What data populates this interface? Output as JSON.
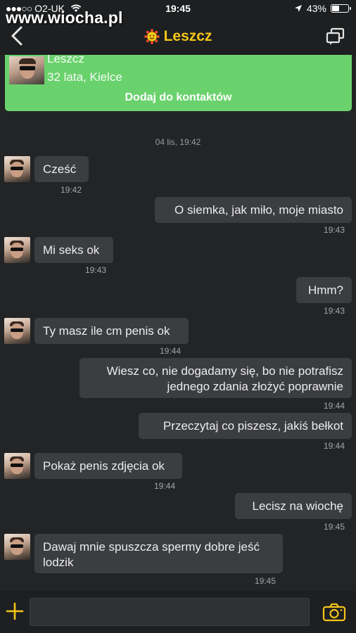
{
  "status_bar": {
    "carrier": "O2-UK",
    "time": "19:45",
    "battery": "43%",
    "battery_level": 0.43
  },
  "watermark": "www.wiocha.pl",
  "nav": {
    "title": "Leszcz",
    "icons": {
      "back": "chevron-left-icon",
      "title": "sun-smiley-icon",
      "action": "switch-windows-icon"
    }
  },
  "profile_card": {
    "name": "Leszcz",
    "details": "32 lata, Kielce",
    "add_button": "Dodaj do kontaktów",
    "color": "#6ad26d"
  },
  "date_separator": "04 lis, 19:42",
  "messages": [
    {
      "side": "in",
      "text": "Cześć",
      "time": "19:42"
    },
    {
      "side": "out",
      "text": "O siemka, jak miło, moje miasto",
      "time": "19:43"
    },
    {
      "side": "in",
      "text": "Mi seks ok",
      "time": "19:43"
    },
    {
      "side": "out",
      "text": "Hmm?",
      "time": "19:43"
    },
    {
      "side": "in",
      "text": "Ty masz ile cm penis ok",
      "time": "19:44"
    },
    {
      "side": "out",
      "text_lines": [
        "Wiesz co, nie dogadamy się, bo nie potrafisz",
        "jednego zdania złożyć poprawnie"
      ],
      "time": "19:44"
    },
    {
      "side": "out",
      "text": "Przeczytaj co piszesz, jakiś bełkot",
      "time": "19:44"
    },
    {
      "side": "in",
      "text": "Pokaż penis zdjęcia ok",
      "time": "19:44"
    },
    {
      "side": "out",
      "text": "Lecisz na wiochę",
      "time": "19:45"
    },
    {
      "side": "in",
      "text_lines": [
        "Dawaj mnie spuszcza spermy dobre jeść",
        "lodzik"
      ],
      "time": "19:45"
    }
  ],
  "composer": {
    "value": "",
    "placeholder": "",
    "icons": {
      "add": "plus-icon",
      "camera": "camera-icon"
    }
  },
  "colors": {
    "accent": "#f5c518",
    "background": "#222426",
    "bubble": "#3b3d40",
    "bar": "#1d1f21"
  }
}
